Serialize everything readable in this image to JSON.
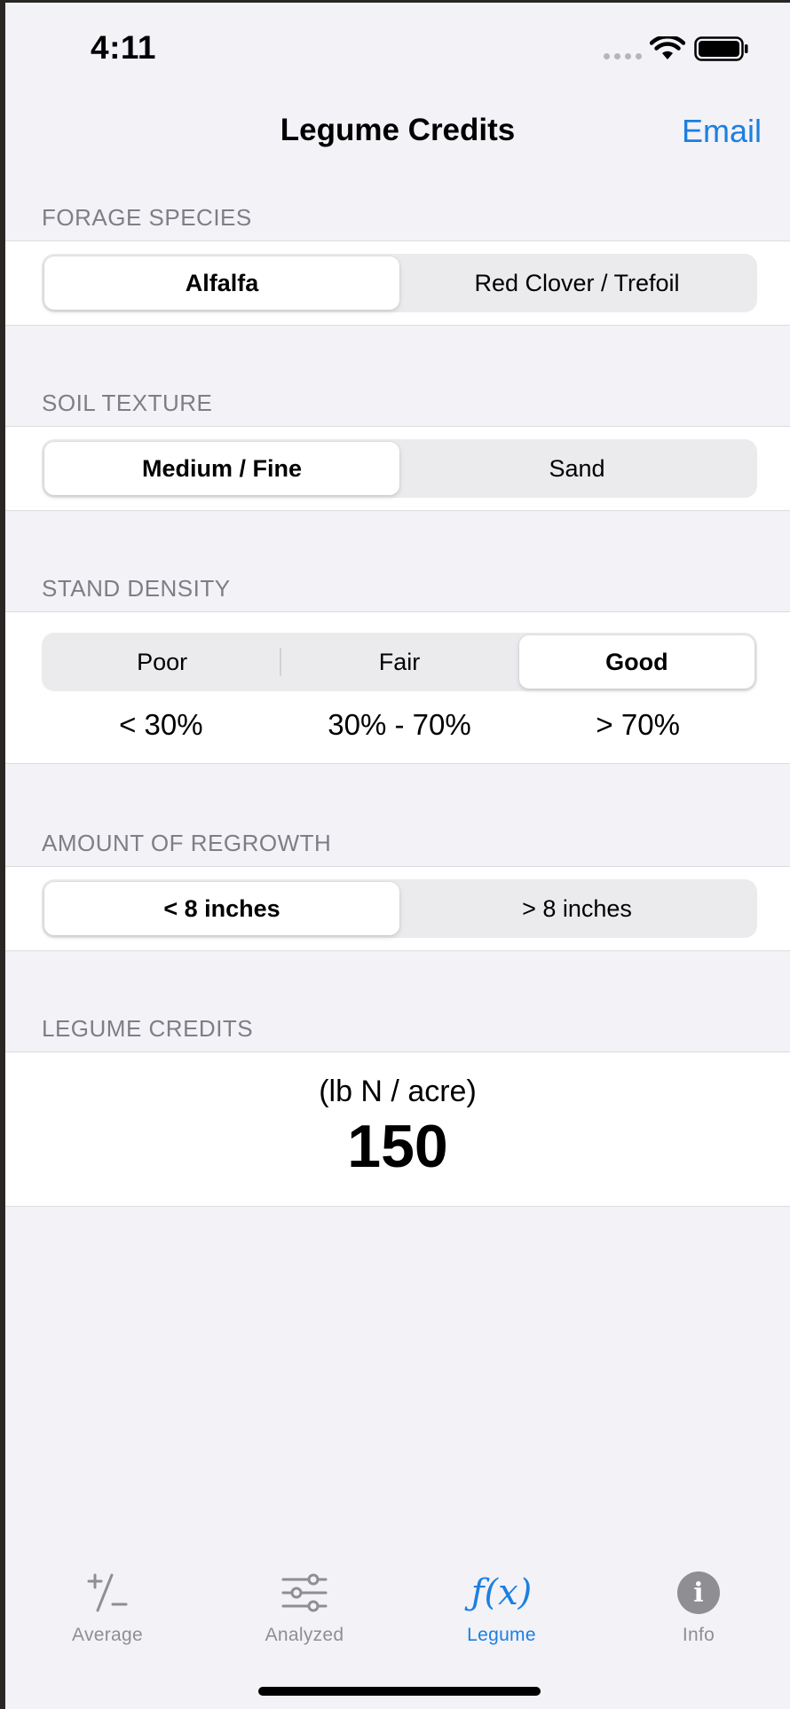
{
  "status_bar": {
    "time": "4:11"
  },
  "nav": {
    "title": "Legume Credits",
    "email_label": "Email"
  },
  "forage_species": {
    "header": "FORAGE SPECIES",
    "options": [
      "Alfalfa",
      "Red Clover / Trefoil"
    ],
    "selected": "Alfalfa"
  },
  "soil_texture": {
    "header": "SOIL TEXTURE",
    "options": [
      "Medium / Fine",
      "Sand"
    ],
    "selected": "Medium / Fine"
  },
  "stand_density": {
    "header": "STAND DENSITY",
    "options": [
      "Poor",
      "Fair",
      "Good"
    ],
    "selected": "Good",
    "ranges": [
      "< 30%",
      "30% - 70%",
      "> 70%"
    ]
  },
  "regrowth": {
    "header": "AMOUNT OF REGROWTH",
    "options": [
      "< 8 inches",
      "> 8 inches"
    ],
    "selected": "< 8 inches"
  },
  "result": {
    "header": "LEGUME CREDITS",
    "unit": "(lb N / acre)",
    "value": "150"
  },
  "tab_bar": {
    "tabs": [
      {
        "label": "Average",
        "icon": "plus-minus-icon"
      },
      {
        "label": "Analyzed",
        "icon": "sliders-icon"
      },
      {
        "label": "Legume",
        "icon": "function-icon",
        "icon_text": "ƒ(x)"
      },
      {
        "label": "Info",
        "icon": "info-icon",
        "icon_text": "i"
      }
    ],
    "active": "Legume"
  },
  "colors": {
    "accent": "#1c7fe0",
    "background": "#f2f2f7",
    "section_header": "#7e7e84",
    "inactive_tab": "#8e8e93"
  }
}
